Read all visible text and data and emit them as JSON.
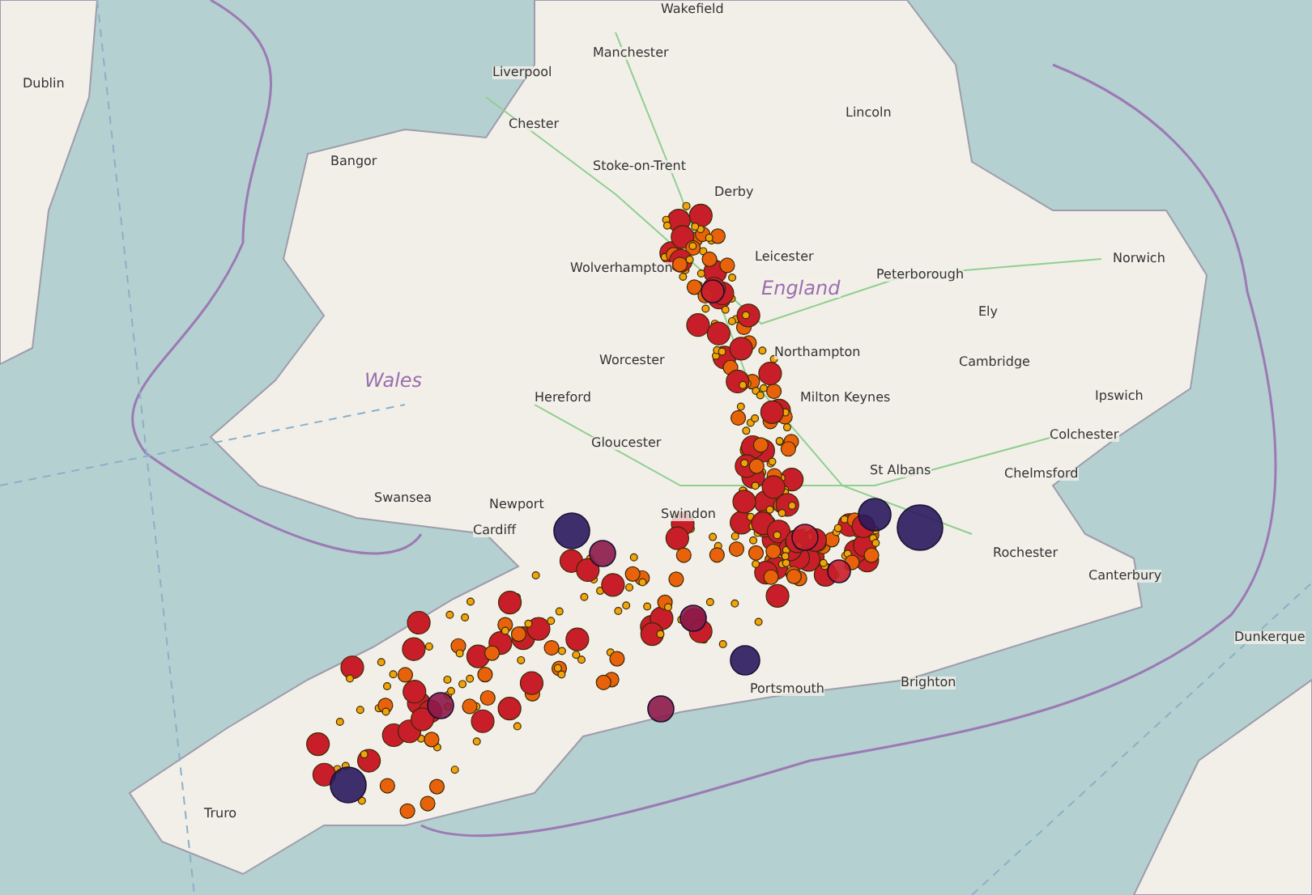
{
  "map": {
    "labels": [
      {
        "text": "Wakefield",
        "kind": "city"
      },
      {
        "text": "Dublin",
        "kind": "city"
      },
      {
        "text": "Manchester",
        "kind": "city"
      },
      {
        "text": "Liverpool",
        "kind": "city"
      },
      {
        "text": "Chester",
        "kind": "city"
      },
      {
        "text": "Bangor",
        "kind": "city"
      },
      {
        "text": "Lincoln",
        "kind": "city"
      },
      {
        "text": "Stoke-on-Trent",
        "kind": "city"
      },
      {
        "text": "Derby",
        "kind": "city"
      },
      {
        "text": "Leicester",
        "kind": "city"
      },
      {
        "text": "Norwich",
        "kind": "city"
      },
      {
        "text": "Wolverhampton",
        "kind": "city"
      },
      {
        "text": "Peterborough",
        "kind": "city"
      },
      {
        "text": "England",
        "kind": "region"
      },
      {
        "text": "Ely",
        "kind": "city"
      },
      {
        "text": "Northampton",
        "kind": "city"
      },
      {
        "text": "Cambridge",
        "kind": "city"
      },
      {
        "text": "Worcester",
        "kind": "city"
      },
      {
        "text": "Wales",
        "kind": "region"
      },
      {
        "text": "Hereford",
        "kind": "city"
      },
      {
        "text": "Milton Keynes",
        "kind": "city"
      },
      {
        "text": "Ipswich",
        "kind": "city"
      },
      {
        "text": "Colchester",
        "kind": "city"
      },
      {
        "text": "Gloucester",
        "kind": "city"
      },
      {
        "text": "St Albans",
        "kind": "city"
      },
      {
        "text": "Chelmsford",
        "kind": "city"
      },
      {
        "text": "Swansea",
        "kind": "city"
      },
      {
        "text": "Newport",
        "kind": "city"
      },
      {
        "text": "Swindon",
        "kind": "city"
      },
      {
        "text": "Cardiff",
        "kind": "city"
      },
      {
        "text": "Rochester",
        "kind": "city"
      },
      {
        "text": "Canterbury",
        "kind": "city"
      },
      {
        "text": "Dunkerque",
        "kind": "city"
      },
      {
        "text": "Brighton",
        "kind": "city"
      },
      {
        "text": "Portsmouth",
        "kind": "city"
      },
      {
        "text": "Truro",
        "kind": "city"
      }
    ]
  }
}
